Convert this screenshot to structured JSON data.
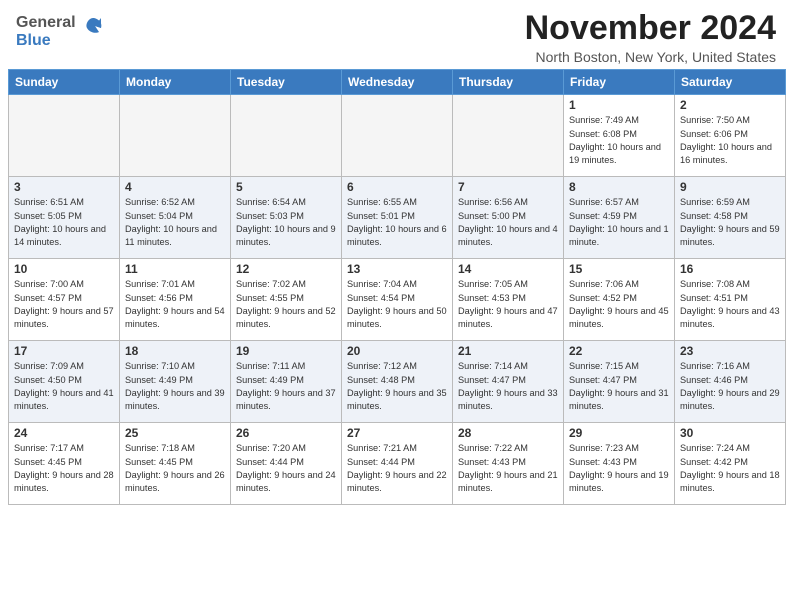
{
  "header": {
    "logo_general": "General",
    "logo_blue": "Blue",
    "title": "November 2024",
    "subtitle": "North Boston, New York, United States"
  },
  "calendar": {
    "days_of_week": [
      "Sunday",
      "Monday",
      "Tuesday",
      "Wednesday",
      "Thursday",
      "Friday",
      "Saturday"
    ],
    "weeks": [
      [
        {
          "num": "",
          "info": "",
          "empty": true
        },
        {
          "num": "",
          "info": "",
          "empty": true
        },
        {
          "num": "",
          "info": "",
          "empty": true
        },
        {
          "num": "",
          "info": "",
          "empty": true
        },
        {
          "num": "",
          "info": "",
          "empty": true
        },
        {
          "num": "1",
          "info": "Sunrise: 7:49 AM\nSunset: 6:08 PM\nDaylight: 10 hours and 19 minutes."
        },
        {
          "num": "2",
          "info": "Sunrise: 7:50 AM\nSunset: 6:06 PM\nDaylight: 10 hours and 16 minutes."
        }
      ],
      [
        {
          "num": "3",
          "info": "Sunrise: 6:51 AM\nSunset: 5:05 PM\nDaylight: 10 hours and 14 minutes."
        },
        {
          "num": "4",
          "info": "Sunrise: 6:52 AM\nSunset: 5:04 PM\nDaylight: 10 hours and 11 minutes."
        },
        {
          "num": "5",
          "info": "Sunrise: 6:54 AM\nSunset: 5:03 PM\nDaylight: 10 hours and 9 minutes."
        },
        {
          "num": "6",
          "info": "Sunrise: 6:55 AM\nSunset: 5:01 PM\nDaylight: 10 hours and 6 minutes."
        },
        {
          "num": "7",
          "info": "Sunrise: 6:56 AM\nSunset: 5:00 PM\nDaylight: 10 hours and 4 minutes."
        },
        {
          "num": "8",
          "info": "Sunrise: 6:57 AM\nSunset: 4:59 PM\nDaylight: 10 hours and 1 minute."
        },
        {
          "num": "9",
          "info": "Sunrise: 6:59 AM\nSunset: 4:58 PM\nDaylight: 9 hours and 59 minutes."
        }
      ],
      [
        {
          "num": "10",
          "info": "Sunrise: 7:00 AM\nSunset: 4:57 PM\nDaylight: 9 hours and 57 minutes."
        },
        {
          "num": "11",
          "info": "Sunrise: 7:01 AM\nSunset: 4:56 PM\nDaylight: 9 hours and 54 minutes."
        },
        {
          "num": "12",
          "info": "Sunrise: 7:02 AM\nSunset: 4:55 PM\nDaylight: 9 hours and 52 minutes."
        },
        {
          "num": "13",
          "info": "Sunrise: 7:04 AM\nSunset: 4:54 PM\nDaylight: 9 hours and 50 minutes."
        },
        {
          "num": "14",
          "info": "Sunrise: 7:05 AM\nSunset: 4:53 PM\nDaylight: 9 hours and 47 minutes."
        },
        {
          "num": "15",
          "info": "Sunrise: 7:06 AM\nSunset: 4:52 PM\nDaylight: 9 hours and 45 minutes."
        },
        {
          "num": "16",
          "info": "Sunrise: 7:08 AM\nSunset: 4:51 PM\nDaylight: 9 hours and 43 minutes."
        }
      ],
      [
        {
          "num": "17",
          "info": "Sunrise: 7:09 AM\nSunset: 4:50 PM\nDaylight: 9 hours and 41 minutes."
        },
        {
          "num": "18",
          "info": "Sunrise: 7:10 AM\nSunset: 4:49 PM\nDaylight: 9 hours and 39 minutes."
        },
        {
          "num": "19",
          "info": "Sunrise: 7:11 AM\nSunset: 4:49 PM\nDaylight: 9 hours and 37 minutes."
        },
        {
          "num": "20",
          "info": "Sunrise: 7:12 AM\nSunset: 4:48 PM\nDaylight: 9 hours and 35 minutes."
        },
        {
          "num": "21",
          "info": "Sunrise: 7:14 AM\nSunset: 4:47 PM\nDaylight: 9 hours and 33 minutes."
        },
        {
          "num": "22",
          "info": "Sunrise: 7:15 AM\nSunset: 4:47 PM\nDaylight: 9 hours and 31 minutes."
        },
        {
          "num": "23",
          "info": "Sunrise: 7:16 AM\nSunset: 4:46 PM\nDaylight: 9 hours and 29 minutes."
        }
      ],
      [
        {
          "num": "24",
          "info": "Sunrise: 7:17 AM\nSunset: 4:45 PM\nDaylight: 9 hours and 28 minutes."
        },
        {
          "num": "25",
          "info": "Sunrise: 7:18 AM\nSunset: 4:45 PM\nDaylight: 9 hours and 26 minutes."
        },
        {
          "num": "26",
          "info": "Sunrise: 7:20 AM\nSunset: 4:44 PM\nDaylight: 9 hours and 24 minutes."
        },
        {
          "num": "27",
          "info": "Sunrise: 7:21 AM\nSunset: 4:44 PM\nDaylight: 9 hours and 22 minutes."
        },
        {
          "num": "28",
          "info": "Sunrise: 7:22 AM\nSunset: 4:43 PM\nDaylight: 9 hours and 21 minutes."
        },
        {
          "num": "29",
          "info": "Sunrise: 7:23 AM\nSunset: 4:43 PM\nDaylight: 9 hours and 19 minutes."
        },
        {
          "num": "30",
          "info": "Sunrise: 7:24 AM\nSunset: 4:42 PM\nDaylight: 9 hours and 18 minutes."
        }
      ]
    ]
  }
}
